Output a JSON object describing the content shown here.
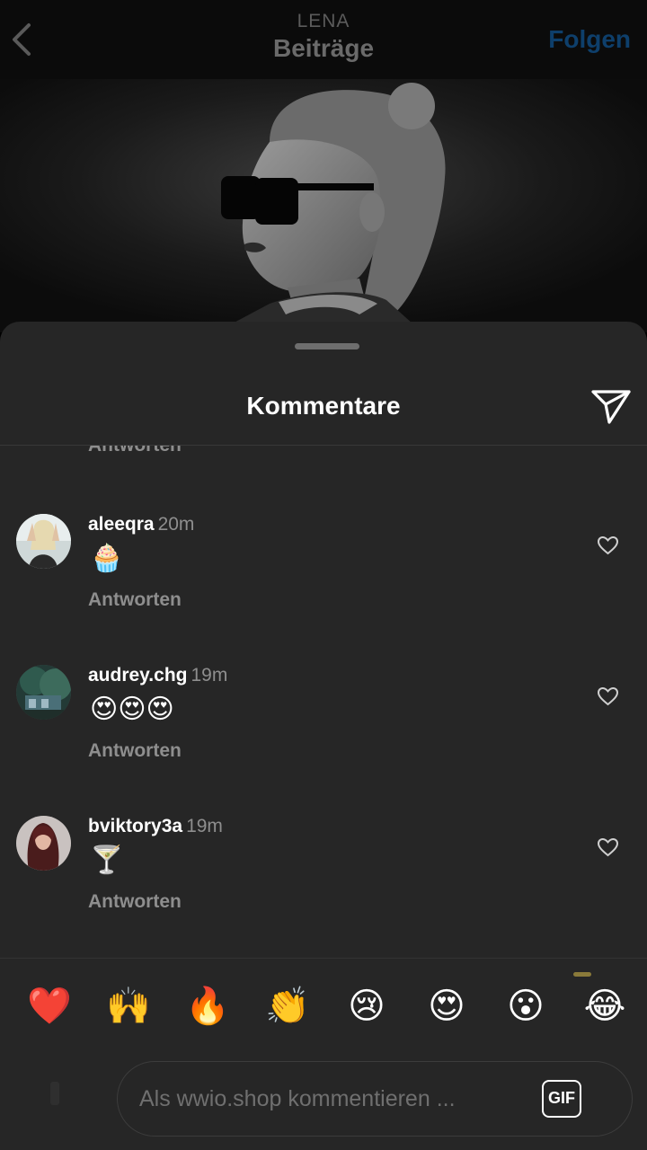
{
  "header": {
    "subtitle": "LENA",
    "title": "Beiträge",
    "follow_label": "Folgen"
  },
  "sheet": {
    "title": "Kommentare"
  },
  "cut_reply_label": "Antworten",
  "comments": [
    {
      "username": "aleeqra",
      "time": "20m",
      "text": "🧁",
      "reply_label": "Antworten"
    },
    {
      "username": "audrey.chg",
      "time": "19m",
      "text": "😍😍😍",
      "reply_label": "Antworten"
    },
    {
      "username": "bviktory3a",
      "time": "19m",
      "text": "🍸",
      "reply_label": "Antworten"
    }
  ],
  "quick_emojis": [
    {
      "name": "heart",
      "glyph": "❤️"
    },
    {
      "name": "raised-hands",
      "glyph": "🙌"
    },
    {
      "name": "fire",
      "glyph": "🔥"
    },
    {
      "name": "clapping-hands",
      "glyph": "👏"
    },
    {
      "name": "crying-face",
      "glyph": "😢"
    },
    {
      "name": "heart-eyes",
      "glyph": "😍"
    },
    {
      "name": "surprised-face",
      "glyph": "😮"
    },
    {
      "name": "tears-of-joy",
      "glyph": "😂"
    }
  ],
  "composer": {
    "placeholder": "Als wwio.shop kommentieren ...",
    "gif_label": "GIF"
  },
  "colors": {
    "sheet_bg": "#262626",
    "follow_blue": "#0e3f6b",
    "muted_text": "#8e8e8e"
  }
}
